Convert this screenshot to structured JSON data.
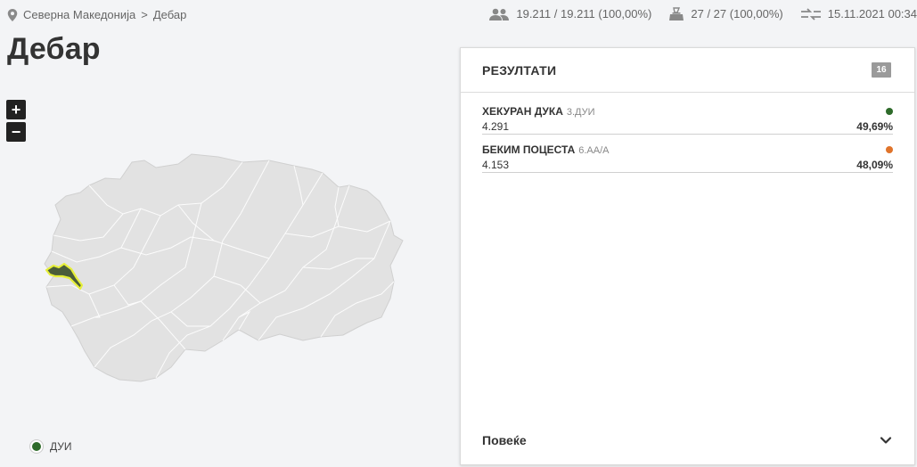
{
  "breadcrumb": {
    "country": "Северна Македонија",
    "separator": ">",
    "current": "Дебар"
  },
  "stats": {
    "voters": "19.211 / 19.211 (100,00%)",
    "polling_stations": "27 / 27 (100,00%)",
    "updated": "15.11.2021 00:34"
  },
  "page_title": "Дебар",
  "map": {
    "zoom_in": "+",
    "zoom_out": "−",
    "highlight_color": "#4a5d3a",
    "highlight_stroke": "#e6ef3a",
    "base_color": "#e2e2e2"
  },
  "legend": {
    "label": "ДУИ",
    "color": "#2e6b2a"
  },
  "panel": {
    "title": "РЕЗУЛТАТИ",
    "badge": "16",
    "more_label": "Повеќе",
    "results": [
      {
        "name": "ХЕКУРАН ДУКА",
        "party": "3.ДУИ",
        "votes": "4.291",
        "percent": "49,69%",
        "color": "#2e6b2a"
      },
      {
        "name": "БЕКИМ ПОЦЕСТА",
        "party": "6.АА/А",
        "votes": "4.153",
        "percent": "48,09%",
        "color": "#e0742b"
      }
    ]
  }
}
